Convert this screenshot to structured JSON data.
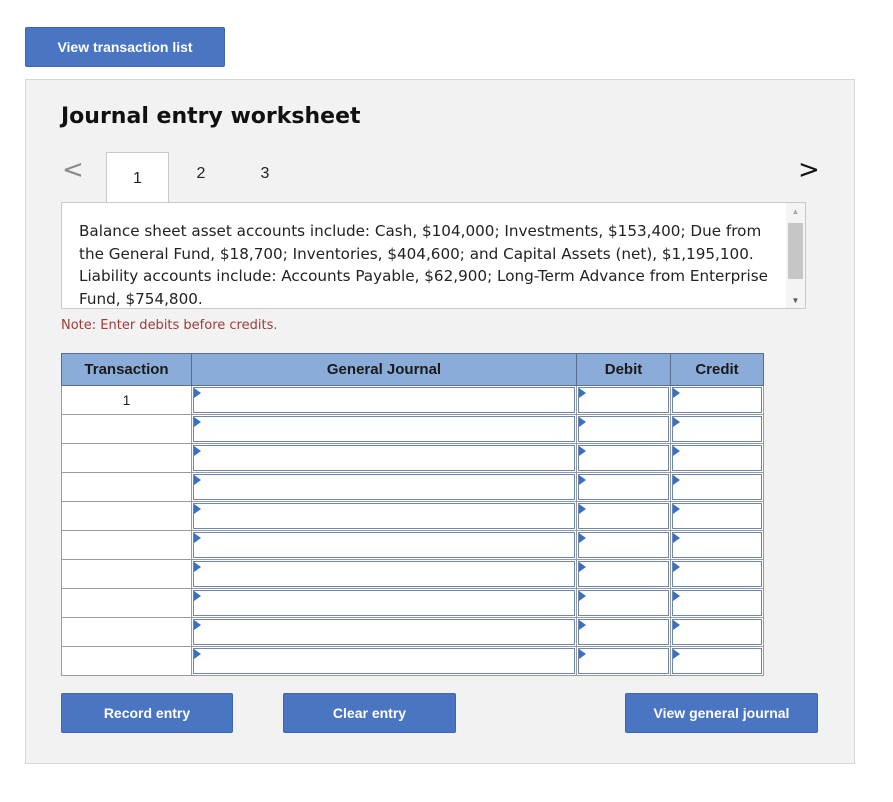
{
  "top_button": {
    "label": "View transaction list"
  },
  "worksheet": {
    "title": "Journal entry worksheet",
    "prev_arrow": "<",
    "next_arrow": ">",
    "tabs": [
      "1",
      "2",
      "3"
    ],
    "active_tab": "1",
    "description": "Balance sheet asset accounts include: Cash, $104,000; Investments, $153,400; Due from the General Fund, $18,700; Inventories, $404,600; and Capital Assets (net), $1,195,100. Liability accounts include: Accounts Payable, $62,900; Long-Term Advance from Enterprise Fund, $754,800.",
    "note": "Note: Enter debits before credits."
  },
  "table": {
    "headers": [
      "Transaction",
      "General Journal",
      "Debit",
      "Credit"
    ],
    "rows": [
      {
        "transaction": "1"
      },
      {
        "transaction": ""
      },
      {
        "transaction": ""
      },
      {
        "transaction": ""
      },
      {
        "transaction": ""
      },
      {
        "transaction": ""
      },
      {
        "transaction": ""
      },
      {
        "transaction": ""
      },
      {
        "transaction": ""
      },
      {
        "transaction": ""
      }
    ]
  },
  "buttons": {
    "record": "Record entry",
    "clear": "Clear entry",
    "view_general_journal": "View general journal"
  },
  "colors": {
    "button": "#4a75c2",
    "header": "#8bacd8",
    "note": "#a23a3a"
  }
}
